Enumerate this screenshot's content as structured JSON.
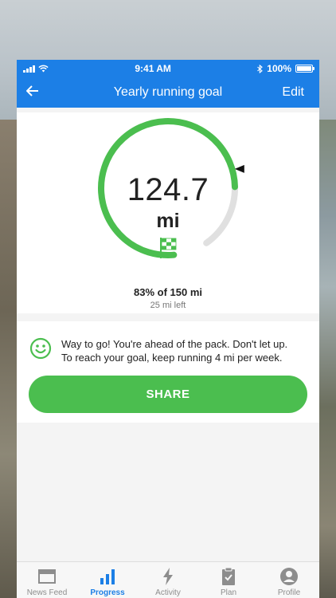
{
  "status": {
    "time": "9:41 AM",
    "battery": "100%"
  },
  "header": {
    "title": "Yearly running goal",
    "edit_label": "Edit"
  },
  "goal": {
    "value": "124.7",
    "unit": "mi",
    "progress_fraction": 0.83,
    "percent_text": "83% of 150 mi",
    "remaining_text": "25 mi left"
  },
  "message": {
    "line1": "Way to go! You're ahead of the pack. Don't let up.",
    "line2": "To reach your goal, keep running 4 mi per week.",
    "share_label": "SHARE"
  },
  "tabs": [
    {
      "label": "News Feed",
      "icon": "news-feed-icon"
    },
    {
      "label": "Progress",
      "icon": "progress-chart-icon"
    },
    {
      "label": "Activity",
      "icon": "lightning-icon"
    },
    {
      "label": "Plan",
      "icon": "clipboard-icon"
    },
    {
      "label": "Profile",
      "icon": "profile-icon"
    }
  ],
  "colors": {
    "brand": "#1c7fe6",
    "accent_green": "#4bbe4f",
    "track_grey": "#e0e0e0"
  }
}
